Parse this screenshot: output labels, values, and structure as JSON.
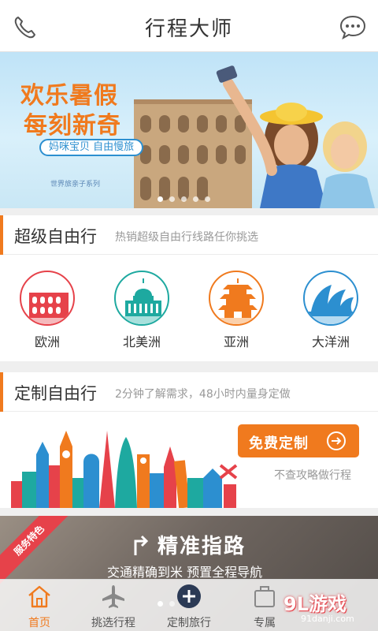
{
  "header": {
    "title": "行程大师",
    "phone_icon": "phone-icon",
    "chat_icon": "chat-bubble-icon"
  },
  "banner": {
    "headline_1": "欢乐暑假",
    "headline_2": "每刻新奇",
    "tagline": "妈咪宝贝 自由慢旅",
    "series": "世界旅亲子系列",
    "colors": {
      "headline": "#f07a1e",
      "tagline": "#2c8fd0"
    }
  },
  "section_free": {
    "title": "超级自由行",
    "subtitle": "热销超级自由行线路任你挑选"
  },
  "regions": [
    {
      "label": "欧洲",
      "icon": "colosseum-icon",
      "color": "#e6424a"
    },
    {
      "label": "北美洲",
      "icon": "capitol-icon",
      "color": "#1ea9a0"
    },
    {
      "label": "亚洲",
      "icon": "pagoda-icon",
      "color": "#f07a1e"
    },
    {
      "label": "大洋洲",
      "icon": "opera-house-icon",
      "color": "#2c8fd0"
    }
  ],
  "section_custom": {
    "title": "定制自由行",
    "subtitle": "2分钟了解需求，48小时内量身定做"
  },
  "custom": {
    "button_label": "免费定制",
    "note": "不查攻略做行程"
  },
  "service": {
    "badge": "服务特色",
    "title": "精准指路",
    "subtitle": "交通精确到米  预置全程导航"
  },
  "nav": [
    {
      "label": "首页",
      "icon": "home-icon",
      "active": true
    },
    {
      "label": "挑选行程",
      "icon": "airplane-icon",
      "active": false
    },
    {
      "label": "定制旅行",
      "icon": "plus-circle-icon",
      "active": false
    },
    {
      "label": "专属",
      "icon": "briefcase-icon",
      "active": false
    }
  ],
  "watermark": {
    "brand": "9L游戏",
    "site": "91danji.com"
  },
  "accent": "#f07a1e"
}
